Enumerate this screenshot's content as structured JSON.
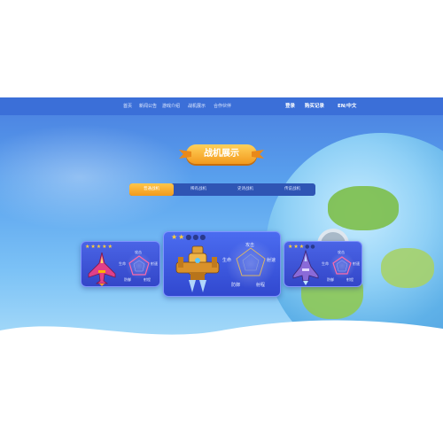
{
  "nav": {
    "links": [
      "首页",
      "新闻公告",
      "游戏介绍",
      "战机展示",
      "合作伙伴"
    ],
    "right": [
      "登录",
      "购买记录",
      "EN/中文"
    ]
  },
  "section": {
    "title": "战机展示"
  },
  "tabs": {
    "items": [
      "普通战机",
      "稀有战机",
      "史诗战机",
      "传说战机"
    ],
    "active": 0
  },
  "cards": [
    {
      "id": "left",
      "stars_on": 5,
      "stars_total": 5,
      "radar_labels": [
        "攻击",
        "射速",
        "射程",
        "防御",
        "生命"
      ]
    },
    {
      "id": "center",
      "stars_on": 2,
      "stars_total": 5,
      "radar_labels": [
        "攻击",
        "射速",
        "射程",
        "防御",
        "生命"
      ]
    },
    {
      "id": "right",
      "stars_on": 3,
      "stars_total": 5,
      "radar_labels": [
        "攻击",
        "射速",
        "射程",
        "防御",
        "生命"
      ]
    }
  ],
  "colors": {
    "nav_bg": "#3b6fd8",
    "accent": "#f5a623",
    "card_bg": "#3d52d8"
  }
}
